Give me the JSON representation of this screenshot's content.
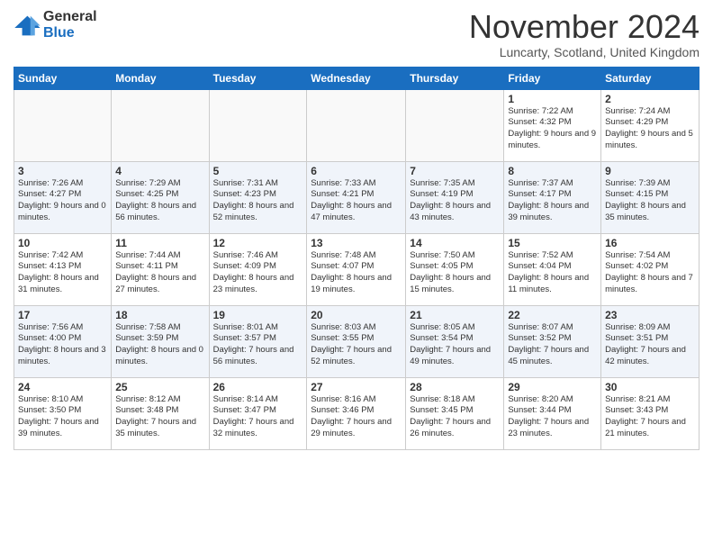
{
  "logo": {
    "general": "General",
    "blue": "Blue"
  },
  "title": "November 2024",
  "location": "Luncarty, Scotland, United Kingdom",
  "days_header": [
    "Sunday",
    "Monday",
    "Tuesday",
    "Wednesday",
    "Thursday",
    "Friday",
    "Saturday"
  ],
  "weeks": [
    [
      {
        "day": "",
        "info": ""
      },
      {
        "day": "",
        "info": ""
      },
      {
        "day": "",
        "info": ""
      },
      {
        "day": "",
        "info": ""
      },
      {
        "day": "",
        "info": ""
      },
      {
        "day": "1",
        "info": "Sunrise: 7:22 AM\nSunset: 4:32 PM\nDaylight: 9 hours and 9 minutes."
      },
      {
        "day": "2",
        "info": "Sunrise: 7:24 AM\nSunset: 4:29 PM\nDaylight: 9 hours and 5 minutes."
      }
    ],
    [
      {
        "day": "3",
        "info": "Sunrise: 7:26 AM\nSunset: 4:27 PM\nDaylight: 9 hours and 0 minutes."
      },
      {
        "day": "4",
        "info": "Sunrise: 7:29 AM\nSunset: 4:25 PM\nDaylight: 8 hours and 56 minutes."
      },
      {
        "day": "5",
        "info": "Sunrise: 7:31 AM\nSunset: 4:23 PM\nDaylight: 8 hours and 52 minutes."
      },
      {
        "day": "6",
        "info": "Sunrise: 7:33 AM\nSunset: 4:21 PM\nDaylight: 8 hours and 47 minutes."
      },
      {
        "day": "7",
        "info": "Sunrise: 7:35 AM\nSunset: 4:19 PM\nDaylight: 8 hours and 43 minutes."
      },
      {
        "day": "8",
        "info": "Sunrise: 7:37 AM\nSunset: 4:17 PM\nDaylight: 8 hours and 39 minutes."
      },
      {
        "day": "9",
        "info": "Sunrise: 7:39 AM\nSunset: 4:15 PM\nDaylight: 8 hours and 35 minutes."
      }
    ],
    [
      {
        "day": "10",
        "info": "Sunrise: 7:42 AM\nSunset: 4:13 PM\nDaylight: 8 hours and 31 minutes."
      },
      {
        "day": "11",
        "info": "Sunrise: 7:44 AM\nSunset: 4:11 PM\nDaylight: 8 hours and 27 minutes."
      },
      {
        "day": "12",
        "info": "Sunrise: 7:46 AM\nSunset: 4:09 PM\nDaylight: 8 hours and 23 minutes."
      },
      {
        "day": "13",
        "info": "Sunrise: 7:48 AM\nSunset: 4:07 PM\nDaylight: 8 hours and 19 minutes."
      },
      {
        "day": "14",
        "info": "Sunrise: 7:50 AM\nSunset: 4:05 PM\nDaylight: 8 hours and 15 minutes."
      },
      {
        "day": "15",
        "info": "Sunrise: 7:52 AM\nSunset: 4:04 PM\nDaylight: 8 hours and 11 minutes."
      },
      {
        "day": "16",
        "info": "Sunrise: 7:54 AM\nSunset: 4:02 PM\nDaylight: 8 hours and 7 minutes."
      }
    ],
    [
      {
        "day": "17",
        "info": "Sunrise: 7:56 AM\nSunset: 4:00 PM\nDaylight: 8 hours and 3 minutes."
      },
      {
        "day": "18",
        "info": "Sunrise: 7:58 AM\nSunset: 3:59 PM\nDaylight: 8 hours and 0 minutes."
      },
      {
        "day": "19",
        "info": "Sunrise: 8:01 AM\nSunset: 3:57 PM\nDaylight: 7 hours and 56 minutes."
      },
      {
        "day": "20",
        "info": "Sunrise: 8:03 AM\nSunset: 3:55 PM\nDaylight: 7 hours and 52 minutes."
      },
      {
        "day": "21",
        "info": "Sunrise: 8:05 AM\nSunset: 3:54 PM\nDaylight: 7 hours and 49 minutes."
      },
      {
        "day": "22",
        "info": "Sunrise: 8:07 AM\nSunset: 3:52 PM\nDaylight: 7 hours and 45 minutes."
      },
      {
        "day": "23",
        "info": "Sunrise: 8:09 AM\nSunset: 3:51 PM\nDaylight: 7 hours and 42 minutes."
      }
    ],
    [
      {
        "day": "24",
        "info": "Sunrise: 8:10 AM\nSunset: 3:50 PM\nDaylight: 7 hours and 39 minutes."
      },
      {
        "day": "25",
        "info": "Sunrise: 8:12 AM\nSunset: 3:48 PM\nDaylight: 7 hours and 35 minutes."
      },
      {
        "day": "26",
        "info": "Sunrise: 8:14 AM\nSunset: 3:47 PM\nDaylight: 7 hours and 32 minutes."
      },
      {
        "day": "27",
        "info": "Sunrise: 8:16 AM\nSunset: 3:46 PM\nDaylight: 7 hours and 29 minutes."
      },
      {
        "day": "28",
        "info": "Sunrise: 8:18 AM\nSunset: 3:45 PM\nDaylight: 7 hours and 26 minutes."
      },
      {
        "day": "29",
        "info": "Sunrise: 8:20 AM\nSunset: 3:44 PM\nDaylight: 7 hours and 23 minutes."
      },
      {
        "day": "30",
        "info": "Sunrise: 8:21 AM\nSunset: 3:43 PM\nDaylight: 7 hours and 21 minutes."
      }
    ]
  ]
}
